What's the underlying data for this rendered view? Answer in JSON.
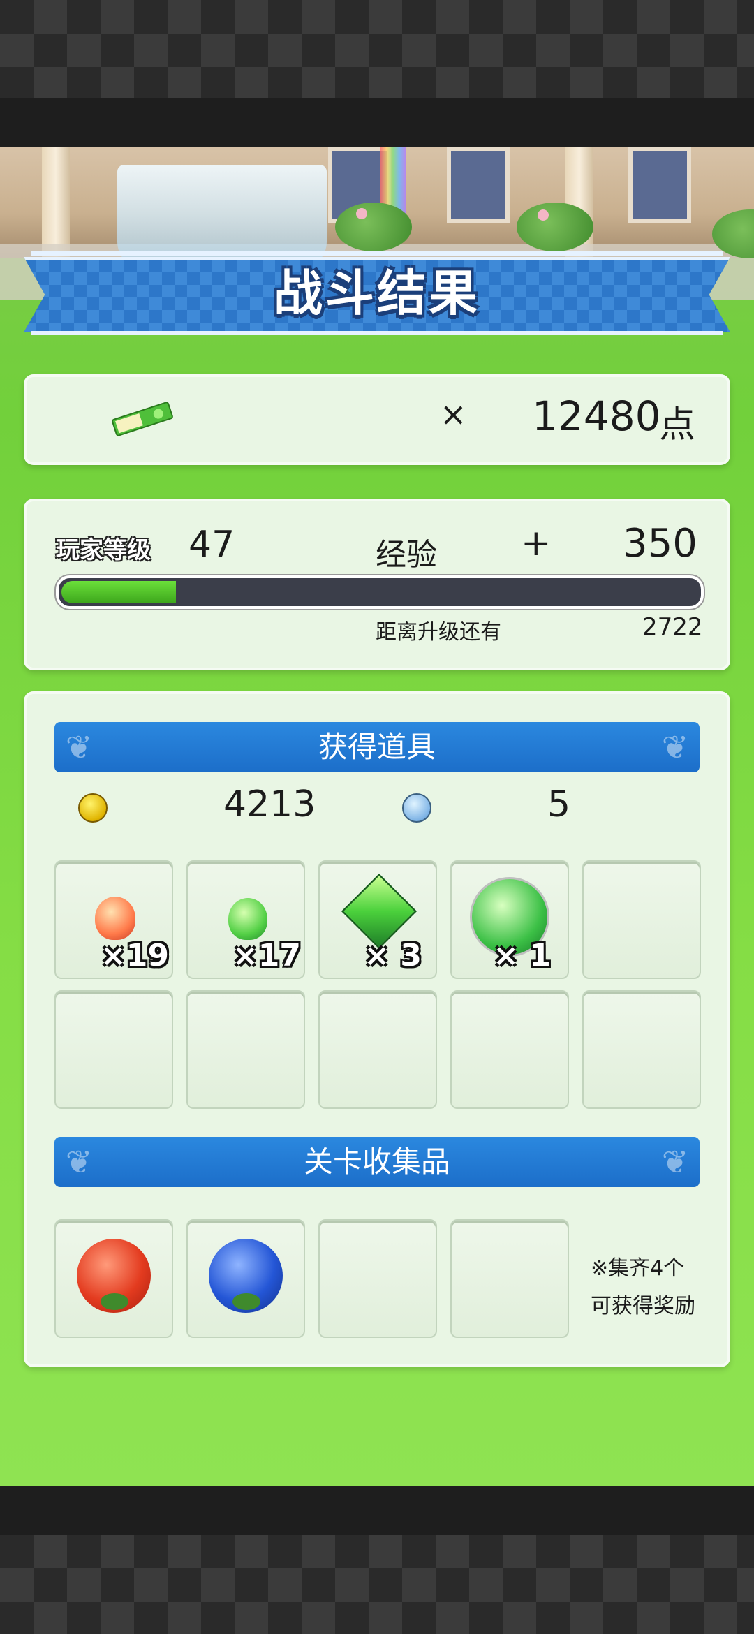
{
  "banner": {
    "title": "战斗结果"
  },
  "points": {
    "icon": "ticket-icon",
    "times": "×",
    "value": "12480",
    "unit": "点"
  },
  "level": {
    "label": "玩家等级",
    "value": "47",
    "exp_label": "经验",
    "exp_plus": "+",
    "exp_gain": "350",
    "progress": 0.18,
    "next_label": "距离升级还有",
    "next_value": "2722"
  },
  "obtained": {
    "header": "获得道具",
    "gold_icon": "gold-coin-icon",
    "gold": "4213",
    "orb_icon": "blue-orb-icon",
    "orbs": "5",
    "items": [
      {
        "icon": "red-gem-icon",
        "qty": "×19"
      },
      {
        "icon": "green-gem-icon",
        "qty": "×17"
      },
      {
        "icon": "green-square-crystal-icon",
        "qty": "× 3"
      },
      {
        "icon": "green-round-crystal-icon",
        "qty": "× 1"
      }
    ]
  },
  "collection": {
    "header": "关卡收集品",
    "items": [
      {
        "icon": "red-ball-icon"
      },
      {
        "icon": "blue-ball-icon"
      }
    ],
    "note_line1": "※集齐4个",
    "note_line2": "可获得奖励"
  },
  "colors": {
    "accent_blue": "#1c6ec9",
    "exp_green": "#3da61c",
    "panel": "#e9f6e4"
  }
}
